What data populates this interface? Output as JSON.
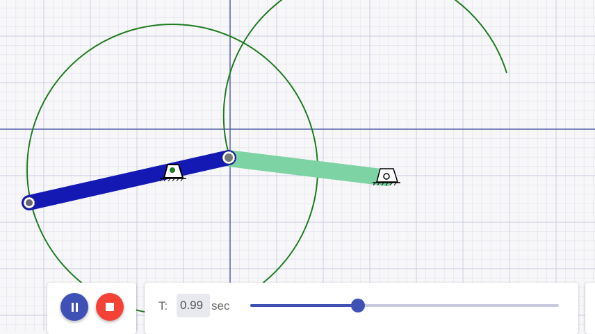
{
  "player": {
    "pause_icon": "pause-icon",
    "stop_icon": "stop-icon"
  },
  "time": {
    "label": "T:",
    "value": "0.99",
    "unit": "sec",
    "progress": 0.35
  },
  "colors": {
    "grid_minor": "#e1e2ec",
    "grid_major": "#c9cbe0",
    "axis": "#5560a8",
    "trajectory": "#1e7b1e",
    "link_blue": "#1419b4",
    "link_green": "#7dd3a3",
    "accent": "#3f51b5",
    "stop": "#f44336"
  }
}
